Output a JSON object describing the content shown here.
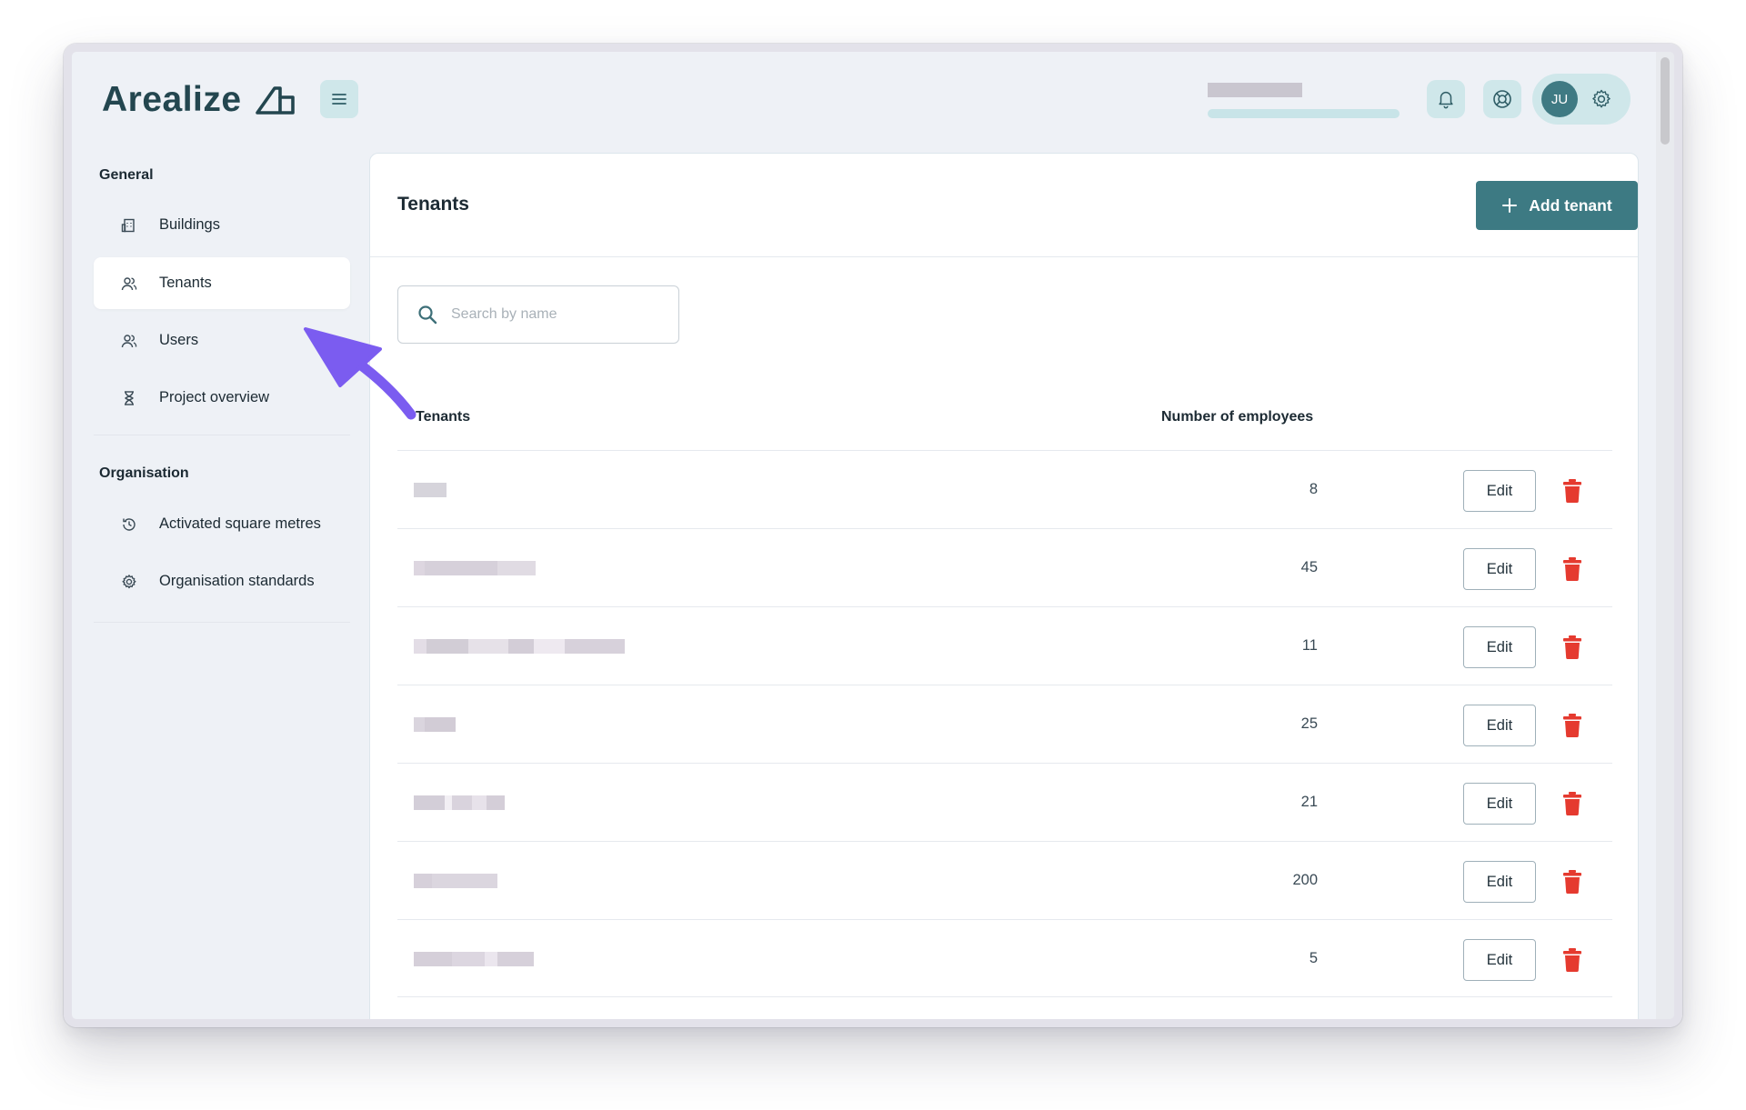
{
  "app": {
    "logo_text": "Arealize",
    "user_initials": "JU"
  },
  "sidebar": {
    "sections": [
      {
        "title": "General",
        "items": [
          {
            "label": "Buildings",
            "icon": "building-icon",
            "active": false
          },
          {
            "label": "Tenants",
            "icon": "users-icon",
            "active": true
          },
          {
            "label": "Users",
            "icon": "users-icon",
            "active": false
          },
          {
            "label": "Project overview",
            "icon": "hourglass-icon",
            "active": false
          }
        ]
      },
      {
        "title": "Organisation",
        "items": [
          {
            "label": "Activated square metres",
            "icon": "history-icon",
            "active": false
          },
          {
            "label": "Organisation standards",
            "icon": "gear-icon",
            "active": false
          }
        ]
      }
    ]
  },
  "main": {
    "title": "Tenants",
    "add_button_label": "Add tenant",
    "search_placeholder": "Search by name",
    "table": {
      "columns": [
        "Tenants",
        "Number of employees"
      ],
      "edit_label": "Edit",
      "rows": [
        {
          "employees": "8"
        },
        {
          "employees": "45"
        },
        {
          "employees": "11"
        },
        {
          "employees": "25"
        },
        {
          "employees": "21"
        },
        {
          "employees": "200"
        },
        {
          "employees": "5"
        }
      ]
    }
  },
  "colors": {
    "accent": "#3d7a83",
    "danger": "#e53a2f",
    "annotation_arrow": "#7b5cf0"
  }
}
